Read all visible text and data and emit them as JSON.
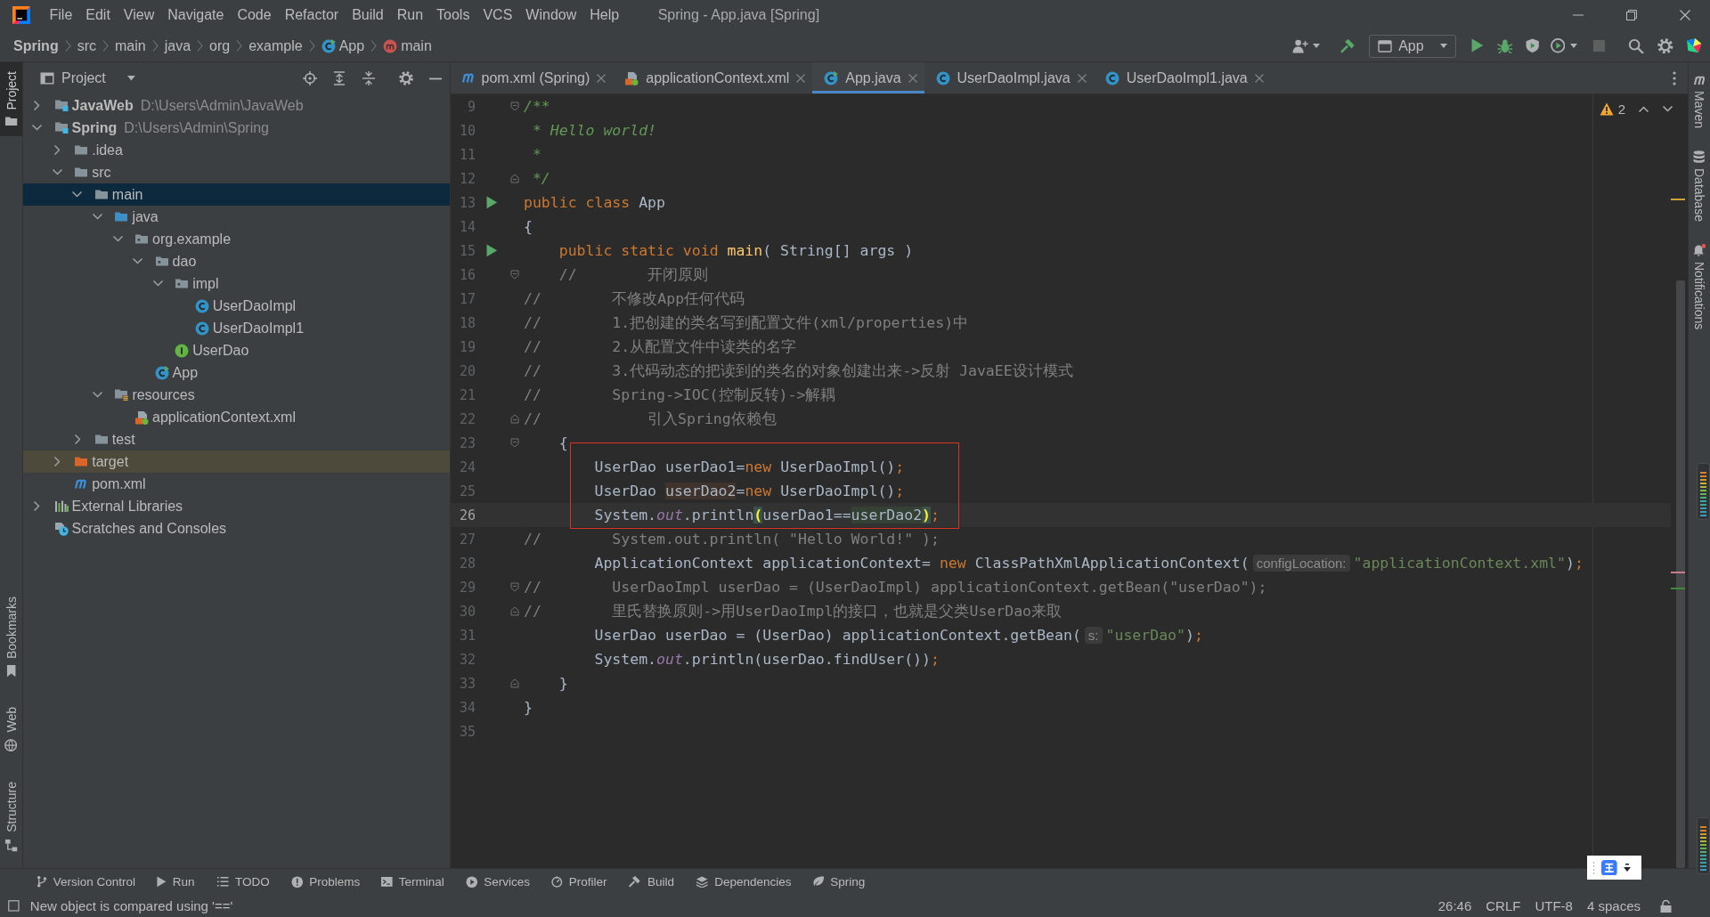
{
  "menu_bar": {
    "items": [
      "File",
      "Edit",
      "View",
      "Navigate",
      "Code",
      "Refactor",
      "Build",
      "Run",
      "Tools",
      "VCS",
      "Window",
      "Help"
    ],
    "title": "Spring - App.java [Spring]"
  },
  "nav_bar": {
    "breadcrumbs": [
      {
        "label": "Spring",
        "kind": "project"
      },
      {
        "label": "src",
        "kind": "folder"
      },
      {
        "label": "main",
        "kind": "folder"
      },
      {
        "label": "java",
        "kind": "folder"
      },
      {
        "label": "org",
        "kind": "folder"
      },
      {
        "label": "example",
        "kind": "folder"
      },
      {
        "label": "App",
        "kind": "main-class"
      },
      {
        "label": "main",
        "kind": "method"
      }
    ],
    "run_config": "App",
    "stop": {
      "disabled": true
    }
  },
  "left_stripe": [
    {
      "label": "Project",
      "kind": "project",
      "selected": true
    },
    {
      "label": "Bookmarks",
      "kind": "bookmarks",
      "selected": false
    },
    {
      "label": "Web",
      "kind": "web",
      "selected": false
    },
    {
      "label": "Structure",
      "kind": "structure",
      "selected": false
    }
  ],
  "project_panel": {
    "title": "Project",
    "tree": [
      {
        "label": "JavaWeb",
        "path": "D:\\Users\\Admin\\JavaWeb",
        "kind": "module",
        "expanded": false,
        "selected": false
      },
      {
        "label": "Spring",
        "path": "D:\\Users\\Admin\\Spring",
        "kind": "module",
        "expanded": true,
        "selected": false,
        "children": [
          {
            "label": ".idea",
            "kind": "folder",
            "expanded": false,
            "selected": false
          },
          {
            "label": "src",
            "kind": "folder",
            "expanded": true,
            "selected": false,
            "children": [
              {
                "label": "main",
                "kind": "folder",
                "expanded": true,
                "selected": true,
                "children": [
                  {
                    "label": "java",
                    "kind": "source-folder",
                    "expanded": true,
                    "selected": false,
                    "children": [
                      {
                        "label": "org.example",
                        "kind": "package",
                        "expanded": true,
                        "selected": false,
                        "children": [
                          {
                            "label": "dao",
                            "kind": "package",
                            "expanded": true,
                            "selected": false,
                            "children": [
                              {
                                "label": "impl",
                                "kind": "package",
                                "expanded": true,
                                "selected": false,
                                "children": [
                                  {
                                    "label": "UserDaoImpl",
                                    "kind": "class",
                                    "selected": false
                                  },
                                  {
                                    "label": "UserDaoImpl1",
                                    "kind": "class",
                                    "selected": false
                                  }
                                ]
                              },
                              {
                                "label": "UserDao",
                                "kind": "interface",
                                "selected": false
                              }
                            ]
                          },
                          {
                            "label": "App",
                            "kind": "main-class",
                            "selected": false
                          }
                        ]
                      }
                    ]
                  },
                  {
                    "label": "resources",
                    "kind": "resources-folder",
                    "expanded": true,
                    "selected": false,
                    "children": [
                      {
                        "label": "applicationContext.xml",
                        "kind": "spring-xml",
                        "selected": false
                      }
                    ]
                  }
                ]
              },
              {
                "label": "test",
                "kind": "folder",
                "expanded": false,
                "selected": false
              }
            ]
          },
          {
            "label": "target",
            "kind": "excluded-folder",
            "expanded": false,
            "selected": false
          },
          {
            "label": "pom.xml",
            "kind": "maven",
            "selected": false
          }
        ]
      },
      {
        "label": "External Libraries",
        "kind": "libraries",
        "expanded": false,
        "selected": false
      },
      {
        "label": "Scratches and Consoles",
        "kind": "scratches",
        "selected": false
      }
    ]
  },
  "tabs": [
    {
      "label": "pom.xml (Spring)",
      "kind": "maven",
      "selected": false
    },
    {
      "label": "applicationContext.xml",
      "kind": "spring-xml",
      "selected": false
    },
    {
      "label": "App.java",
      "kind": "main-class",
      "selected": true
    },
    {
      "label": "UserDaoImpl.java",
      "kind": "class",
      "selected": false
    },
    {
      "label": "UserDaoImpl1.java",
      "kind": "class",
      "selected": false
    }
  ],
  "editor": {
    "warnings": "2",
    "lines": [
      {
        "number": "9",
        "caret": false,
        "boxed": false,
        "gutter": {
          "kind": "fold-start"
        },
        "tokens": [
          {
            "kind": "doc",
            "text": "/**"
          }
        ]
      },
      {
        "number": "10",
        "caret": false,
        "boxed": false,
        "tokens": [
          {
            "kind": "doc",
            "text": " * Hello world!"
          }
        ]
      },
      {
        "number": "11",
        "caret": false,
        "boxed": false,
        "tokens": [
          {
            "kind": "doc",
            "text": " *"
          }
        ]
      },
      {
        "number": "12",
        "caret": false,
        "boxed": false,
        "gutter": {
          "kind": "fold-end"
        },
        "tokens": [
          {
            "kind": "doc",
            "text": " */"
          }
        ]
      },
      {
        "number": "13",
        "caret": false,
        "boxed": false,
        "gutter": {
          "kind": "run"
        },
        "tokens": [
          {
            "kind": "keyword",
            "text": "public class"
          },
          {
            "kind": "plain",
            "text": " App"
          }
        ]
      },
      {
        "number": "14",
        "caret": false,
        "boxed": false,
        "tokens": [
          {
            "kind": "plain",
            "text": "{"
          }
        ]
      },
      {
        "number": "15",
        "caret": false,
        "boxed": false,
        "gutter": {
          "kind": "run"
        },
        "tokens": [
          {
            "kind": "keyword",
            "text": "    public static void"
          },
          {
            "kind": "method",
            "text": " main"
          },
          {
            "kind": "plain",
            "text": "( String[] args )"
          }
        ]
      },
      {
        "number": "16",
        "caret": false,
        "boxed": false,
        "gutter": {
          "kind": "fold-start"
        },
        "tokens": [
          {
            "kind": "comment",
            "text": "    //        开闭原则"
          }
        ]
      },
      {
        "number": "17",
        "caret": false,
        "boxed": false,
        "tokens": [
          {
            "kind": "comment",
            "text": "//        不修改App任何代码"
          }
        ]
      },
      {
        "number": "18",
        "caret": false,
        "boxed": false,
        "tokens": [
          {
            "kind": "comment",
            "text": "//        1.把创建的类名写到配置文件(xml/properties)中"
          }
        ]
      },
      {
        "number": "19",
        "caret": false,
        "boxed": false,
        "tokens": [
          {
            "kind": "comment",
            "text": "//        2.从配置文件中读类的名字"
          }
        ]
      },
      {
        "number": "20",
        "caret": false,
        "boxed": false,
        "tokens": [
          {
            "kind": "comment",
            "text": "//        3.代码动态的把读到的类名的对象创建出来->反射 JavaEE设计模式"
          }
        ]
      },
      {
        "number": "21",
        "caret": false,
        "boxed": false,
        "tokens": [
          {
            "kind": "comment",
            "text": "//        Spring->IOC(控制反转)->解耦"
          }
        ]
      },
      {
        "number": "22",
        "caret": false,
        "boxed": false,
        "gutter": {
          "kind": "fold-end"
        },
        "tokens": [
          {
            "kind": "comment",
            "text": "//            引入Spring依赖包"
          }
        ]
      },
      {
        "number": "23",
        "caret": false,
        "boxed": false,
        "gutter": {
          "kind": "fold-start"
        },
        "tokens": [
          {
            "kind": "plain",
            "text": "    {"
          }
        ]
      },
      {
        "number": "24",
        "caret": false,
        "boxed": true,
        "tokens": [
          {
            "kind": "plain",
            "text": "        UserDao userDao1="
          },
          {
            "kind": "keyword",
            "text": "new"
          },
          {
            "kind": "plain",
            "text": " UserDaoImpl()"
          },
          {
            "kind": "keyword",
            "text": ";"
          }
        ]
      },
      {
        "number": "25",
        "caret": false,
        "boxed": true,
        "tokens": [
          {
            "kind": "plain",
            "text": "        UserDao "
          },
          {
            "kind": "write",
            "text": "userDao2"
          },
          {
            "kind": "plain",
            "text": "="
          },
          {
            "kind": "keyword",
            "text": "new"
          },
          {
            "kind": "plain",
            "text": " UserDaoImpl()"
          },
          {
            "kind": "keyword",
            "text": ";"
          }
        ]
      },
      {
        "number": "26",
        "caret": true,
        "boxed": true,
        "tokens": [
          {
            "kind": "plain",
            "text": "        System."
          },
          {
            "kind": "field",
            "text": "out"
          },
          {
            "kind": "plain",
            "text": ".println"
          },
          {
            "kind": "brace",
            "text": "("
          },
          {
            "kind": "plain",
            "text": "userDao1=="
          },
          {
            "kind": "read",
            "text": "userDao2"
          },
          {
            "kind": "brace",
            "text": ")"
          },
          {
            "kind": "keyword",
            "text": ";"
          }
        ]
      },
      {
        "number": "27",
        "caret": false,
        "boxed": false,
        "tokens": [
          {
            "kind": "comment",
            "text": "//        System.out.println( \"Hello World!\" );"
          }
        ]
      },
      {
        "number": "28",
        "caret": false,
        "boxed": false,
        "tokens": [
          {
            "kind": "plain",
            "text": "        ApplicationContext applicationContext= "
          },
          {
            "kind": "keyword",
            "text": "new"
          },
          {
            "kind": "plain",
            "text": " ClassPathXmlApplicationContext("
          },
          {
            "kind": "hint",
            "text": "configLocation:"
          },
          {
            "kind": "string",
            "text": "\"applicationContext.xml\""
          },
          {
            "kind": "plain",
            "text": ")"
          },
          {
            "kind": "keyword",
            "text": ";"
          }
        ]
      },
      {
        "number": "29",
        "caret": false,
        "boxed": false,
        "gutter": {
          "kind": "fold-start"
        },
        "tokens": [
          {
            "kind": "comment",
            "text": "//        UserDaoImpl userDao = (UserDaoImpl) applicationContext.getBean(\"userDao\");"
          }
        ]
      },
      {
        "number": "30",
        "caret": false,
        "boxed": false,
        "gutter": {
          "kind": "fold-end"
        },
        "tokens": [
          {
            "kind": "comment",
            "text": "//        里氏替换原则->用UserDaoImpl的接口，也就是父类UserDao来取"
          }
        ]
      },
      {
        "number": "31",
        "caret": false,
        "boxed": false,
        "tokens": [
          {
            "kind": "plain",
            "text": "        UserDao userDao = (UserDao) applicationContext.getBean("
          },
          {
            "kind": "hint",
            "text": "s:"
          },
          {
            "kind": "string",
            "text": "\"userDao\""
          },
          {
            "kind": "plain",
            "text": ")"
          },
          {
            "kind": "keyword",
            "text": ";"
          }
        ]
      },
      {
        "number": "32",
        "caret": false,
        "boxed": false,
        "tokens": [
          {
            "kind": "plain",
            "text": "        System."
          },
          {
            "kind": "field",
            "text": "out"
          },
          {
            "kind": "plain",
            "text": ".println(userDao.findUser())"
          },
          {
            "kind": "keyword",
            "text": ";"
          }
        ]
      },
      {
        "number": "33",
        "caret": false,
        "boxed": false,
        "gutter": {
          "kind": "fold-end"
        },
        "tokens": [
          {
            "kind": "plain",
            "text": "    }"
          }
        ]
      },
      {
        "number": "34",
        "caret": false,
        "boxed": false,
        "tokens": [
          {
            "kind": "plain",
            "text": "}"
          }
        ]
      },
      {
        "number": "35",
        "caret": false,
        "boxed": false
      }
    ]
  },
  "right_stripe": [
    {
      "label": "Maven",
      "kind": "maven",
      "unread": false
    },
    {
      "label": "Database",
      "kind": "database",
      "unread": false
    },
    {
      "label": "Notifications",
      "kind": "notifications",
      "unread": true
    }
  ],
  "tool_windows": [
    {
      "label": "Version Control",
      "kind": "vcs"
    },
    {
      "label": "Run",
      "kind": "run"
    },
    {
      "label": "TODO",
      "kind": "todo"
    },
    {
      "label": "Problems",
      "kind": "problems"
    },
    {
      "label": "Terminal",
      "kind": "terminal"
    },
    {
      "label": "Services",
      "kind": "services"
    },
    {
      "label": "Profiler",
      "kind": "profiler"
    },
    {
      "label": "Build",
      "kind": "build"
    },
    {
      "label": "Dependencies",
      "kind": "dependencies"
    },
    {
      "label": "Spring",
      "kind": "spring"
    }
  ],
  "status_bar": {
    "message": "New object is compared using '=='",
    "position": "26:46",
    "line_separator": "CRLF",
    "encoding": "UTF-8",
    "indent": "4 spaces"
  }
}
